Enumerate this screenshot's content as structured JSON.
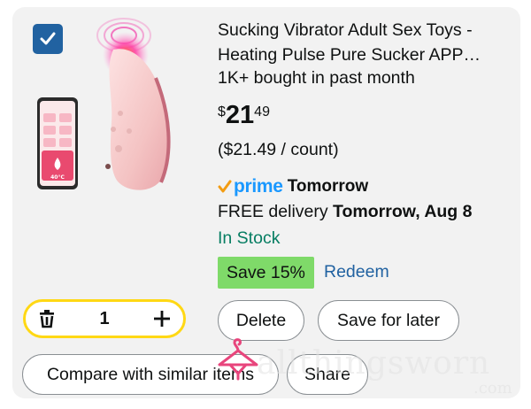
{
  "product": {
    "title_line1": "Sucking Vibrator Adult Sex Toys -",
    "title_line2": "Heating Pulse Pure Sucker APP…",
    "bought": "1K+ bought in past month",
    "price_symbol": "$",
    "price_whole": "21",
    "price_fraction": "49",
    "unit_price": "($21.49 / count)",
    "prime_label": "prime",
    "prime_delivery": "Tomorrow",
    "delivery_prefix": "FREE delivery ",
    "delivery_date": "Tomorrow, Aug 8",
    "stock": "In Stock",
    "save_badge": "Save 15%",
    "redeem": "Redeem",
    "image_temp_label": "40°C"
  },
  "selection": {
    "checked": true
  },
  "quantity": {
    "value": "1"
  },
  "actions": {
    "delete": "Delete",
    "save_for_later": "Save for later",
    "compare": "Compare with similar items",
    "share": "Share"
  },
  "watermark": {
    "text": "allthingsworn",
    "sub": ".com"
  },
  "colors": {
    "card_bg": "#f2f2f2",
    "checkbox": "#2162a1",
    "prime": "#1a98ff",
    "prime_check": "#f39c12",
    "stock": "#067d62",
    "save_badge": "#7fda69",
    "link": "#2162a1",
    "qty_border": "#ffd814"
  }
}
